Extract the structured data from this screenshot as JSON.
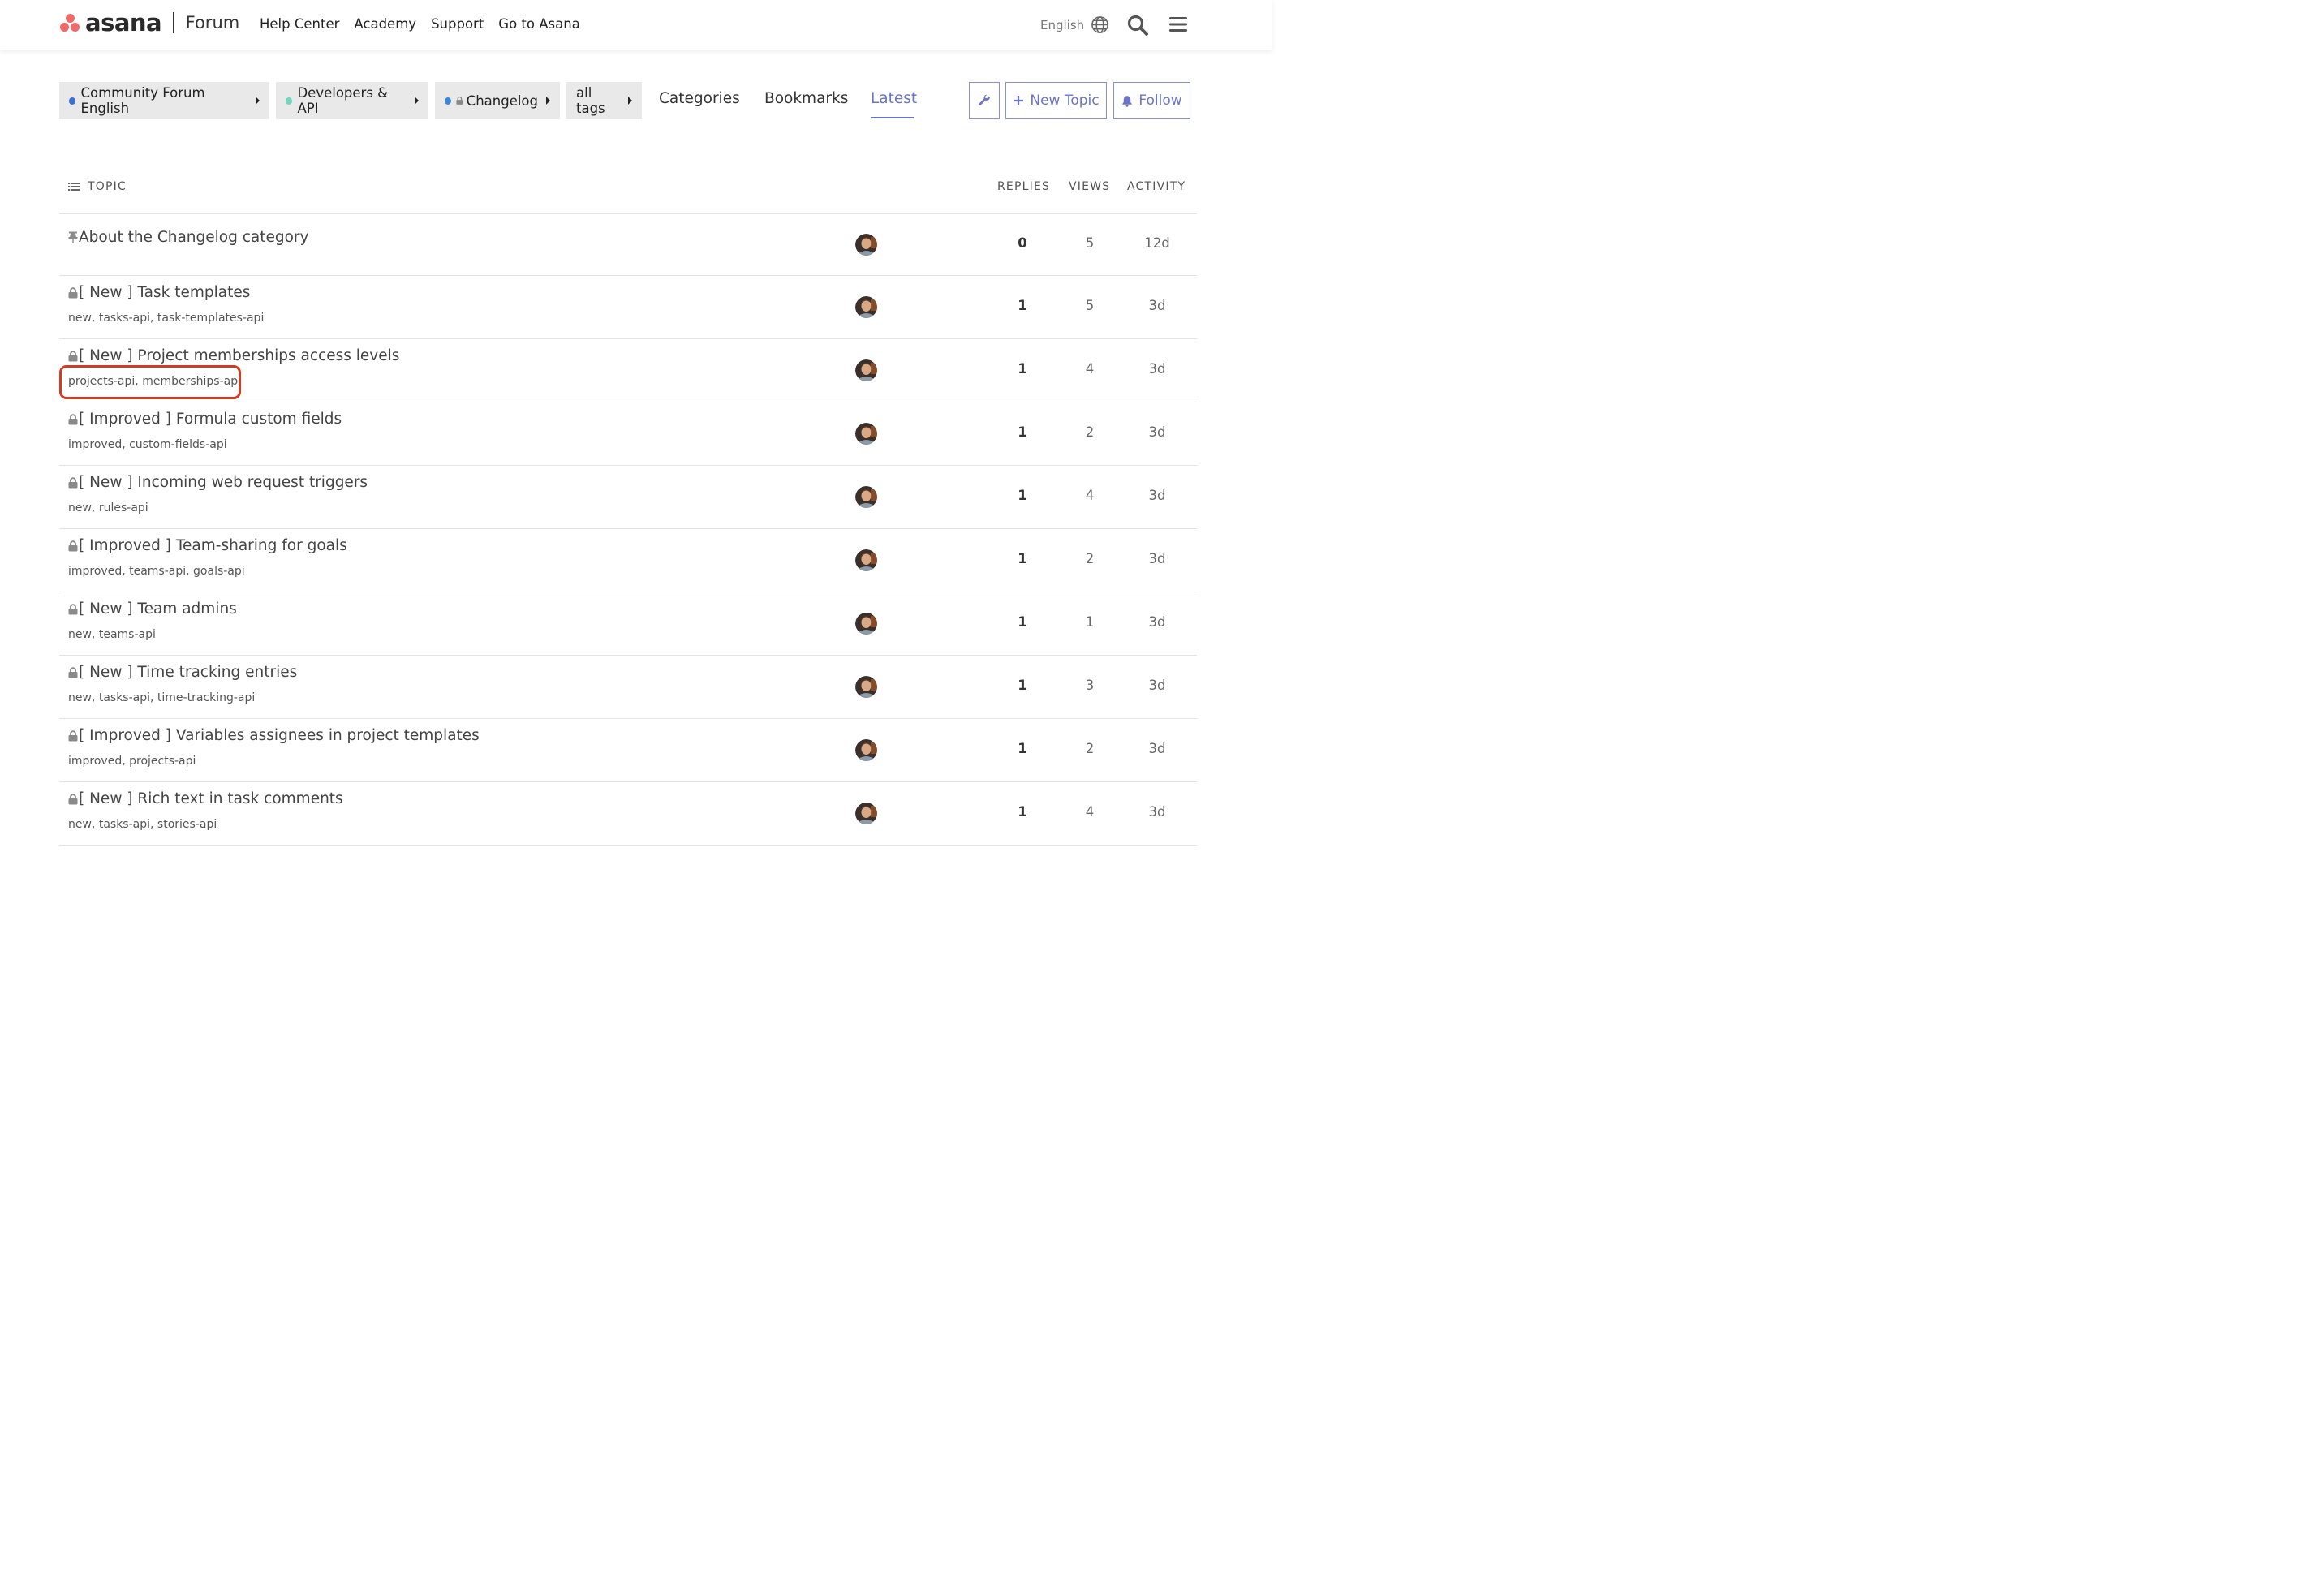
{
  "header": {
    "logo_word": "asana",
    "logo_sub": "Forum",
    "nav": [
      "Help Center",
      "Academy",
      "Support",
      "Go to Asana"
    ],
    "language": "English"
  },
  "breadcrumbs": [
    {
      "label": "Community Forum English",
      "dot_color": "#3b6fd4",
      "locked": false
    },
    {
      "label": "Developers & API",
      "dot_color": "#6fd6c0",
      "locked": false
    },
    {
      "label": "Changelog",
      "dot_color": "#3b86d6",
      "locked": true
    },
    {
      "label": "all tags",
      "dot_color": null,
      "locked": false
    }
  ],
  "nav_links": {
    "categories": "Categories",
    "bookmarks": "Bookmarks",
    "latest": "Latest"
  },
  "buttons": {
    "new_topic": "New Topic",
    "follow": "Follow"
  },
  "table": {
    "headers": {
      "topic": "TOPIC",
      "replies": "REPLIES",
      "views": "VIEWS",
      "activity": "ACTIVITY"
    },
    "rows": [
      {
        "title": "About the Changelog category",
        "pinned": true,
        "locked": false,
        "tags": "",
        "replies": "0",
        "views": "5",
        "activity": "12d"
      },
      {
        "title": "[ New ] Task templates",
        "pinned": false,
        "locked": true,
        "tags": "new, tasks-api, task-templates-api",
        "replies": "1",
        "views": "5",
        "activity": "3d"
      },
      {
        "title": "[ New ] Project memberships access levels",
        "pinned": false,
        "locked": true,
        "tags": "projects-api, memberships-api",
        "replies": "1",
        "views": "4",
        "activity": "3d"
      },
      {
        "title": "[ Improved ] Formula custom fields",
        "pinned": false,
        "locked": true,
        "tags": "improved, custom-fields-api",
        "replies": "1",
        "views": "2",
        "activity": "3d"
      },
      {
        "title": "[ New ] Incoming web request triggers",
        "pinned": false,
        "locked": true,
        "tags": "new, rules-api",
        "replies": "1",
        "views": "4",
        "activity": "3d"
      },
      {
        "title": "[ Improved ] Team-sharing for goals",
        "pinned": false,
        "locked": true,
        "tags": "improved, teams-api, goals-api",
        "replies": "1",
        "views": "2",
        "activity": "3d"
      },
      {
        "title": "[ New ] Team admins",
        "pinned": false,
        "locked": true,
        "tags": "new, teams-api",
        "replies": "1",
        "views": "1",
        "activity": "3d"
      },
      {
        "title": "[ New ] Time tracking entries",
        "pinned": false,
        "locked": true,
        "tags": "new, tasks-api, time-tracking-api",
        "replies": "1",
        "views": "3",
        "activity": "3d"
      },
      {
        "title": "[ Improved ] Variables assignees in project templates",
        "pinned": false,
        "locked": true,
        "tags": "improved, projects-api",
        "replies": "1",
        "views": "2",
        "activity": "3d"
      },
      {
        "title": "[ New ] Rich text in task comments",
        "pinned": false,
        "locked": true,
        "tags": "new, tasks-api, stories-api",
        "replies": "1",
        "views": "4",
        "activity": "3d"
      }
    ]
  },
  "colors": {
    "accent": "#6b74c9",
    "highlight": "#d23b24"
  }
}
